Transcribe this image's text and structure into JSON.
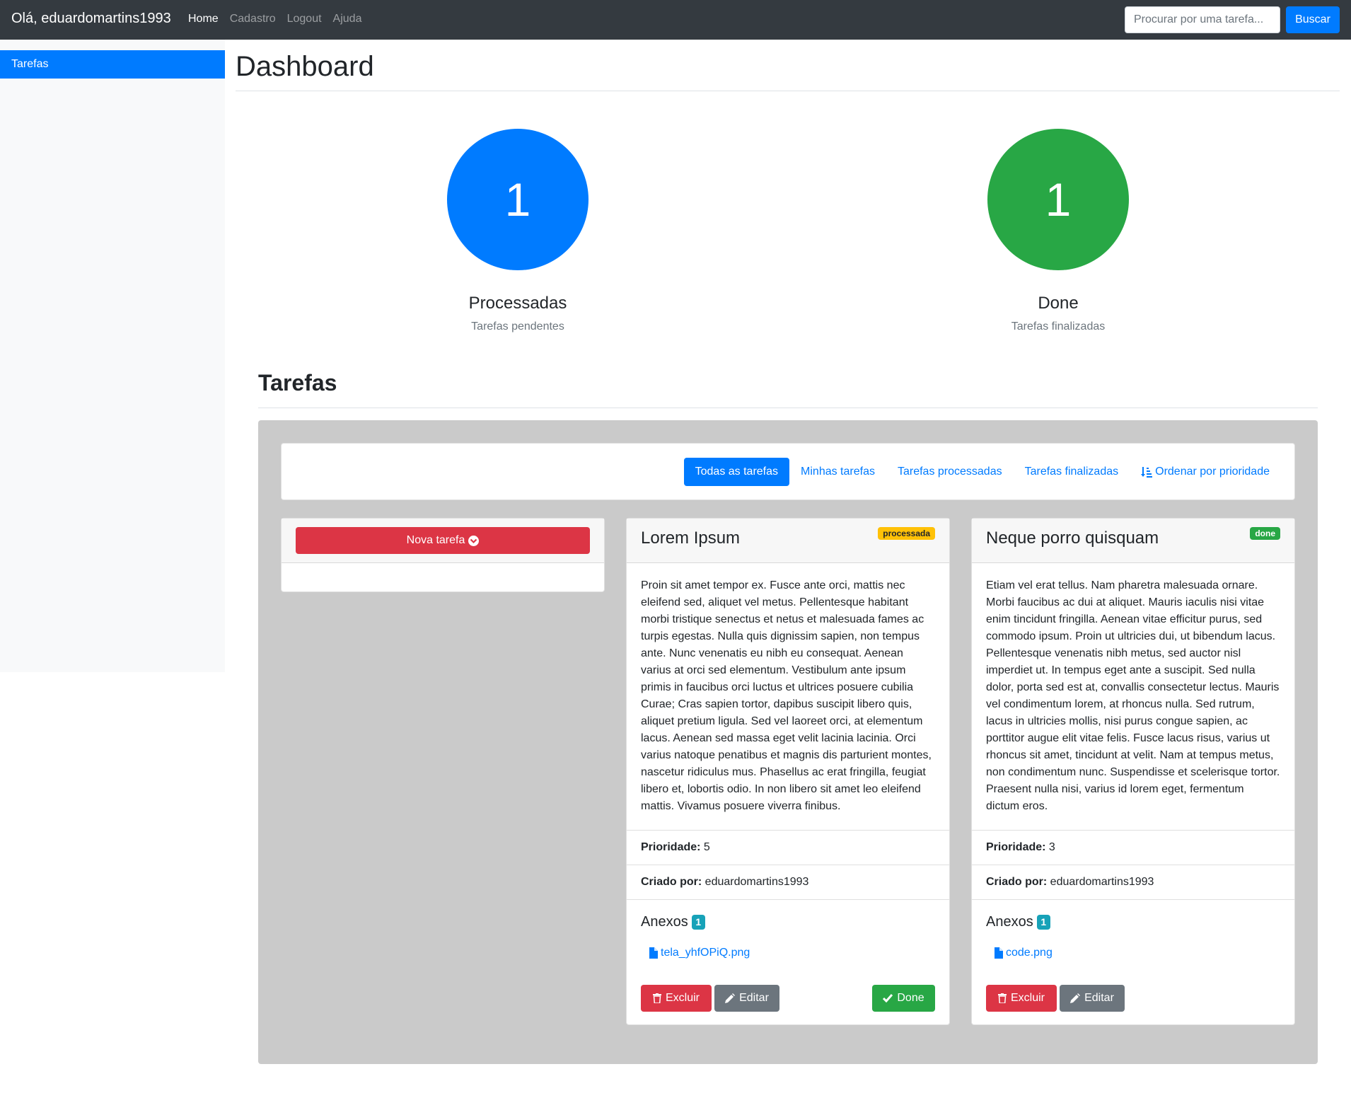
{
  "navbar": {
    "brand": "Olá, eduardomartins1993",
    "links": [
      "Home",
      "Cadastro",
      "Logout",
      "Ajuda"
    ],
    "search_placeholder": "Procurar por uma tarefa...",
    "search_button": "Buscar"
  },
  "sidebar": {
    "items": [
      {
        "label": "Tarefas"
      }
    ]
  },
  "page": {
    "title": "Dashboard",
    "section_title": "Tarefas"
  },
  "stats": [
    {
      "value": "1",
      "label": "Processadas",
      "sub": "Tarefas pendentes",
      "color": "#007bff"
    },
    {
      "value": "1",
      "label": "Done",
      "sub": "Tarefas finalizadas",
      "color": "#28a745"
    }
  ],
  "filters": {
    "tabs": [
      "Todas as tarefas",
      "Minhas tarefas",
      "Tarefas processadas",
      "Tarefas finalizadas"
    ],
    "sort": "Ordenar por prioridade",
    "active": "Todas as tarefas"
  },
  "new_task": {
    "label": "Nova tarefa"
  },
  "labels": {
    "priority": "Prioridade:",
    "created_by": "Criado por:",
    "attachments": "Anexos",
    "delete": "Excluir",
    "edit": "Editar",
    "done": "Done"
  },
  "tasks": [
    {
      "title": "Lorem Ipsum",
      "status": "processada",
      "body": "Proin sit amet tempor ex. Fusce ante orci, mattis nec eleifend sed, aliquet vel metus. Pellentesque habitant morbi tristique senectus et netus et malesuada fames ac turpis egestas. Nulla quis dignissim sapien, non tempus ante. Nunc venenatis eu nibh eu consequat. Aenean varius at orci sed elementum. Vestibulum ante ipsum primis in faucibus orci luctus et ultrices posuere cubilia Curae; Cras sapien tortor, dapibus suscipit libero quis, aliquet pretium ligula. Sed vel laoreet orci, at elementum lacus. Aenean sed massa eget velit lacinia lacinia. Orci varius natoque penatibus et magnis dis parturient montes, nascetur ridiculus mus. Phasellus ac erat fringilla, feugiat libero et, lobortis odio. In non libero sit amet leo eleifend mattis. Vivamus posuere viverra finibus.",
      "priority": "5",
      "created_by": "eduardomartins1993",
      "attachments_count": "1",
      "file": "tela_yhfOPiQ.png"
    },
    {
      "title": "Neque porro quisquam",
      "status": "done",
      "body": "Etiam vel erat tellus. Nam pharetra malesuada ornare. Morbi faucibus ac dui at aliquet. Mauris iaculis nisi vitae enim tincidunt fringilla. Aenean vitae efficitur purus, sed commodo ipsum. Proin ut ultricies dui, ut bibendum lacus. Pellentesque venenatis nibh metus, sed auctor nisl imperdiet ut. In tempus eget ante a suscipit. Sed nulla dolor, porta sed est at, convallis consectetur lectus. Mauris vel condimentum lorem, at rhoncus nulla. Sed rutrum, lacus in ultricies mollis, nisi purus congue sapien, ac porttitor augue elit vitae felis. Fusce lacus risus, varius ut rhoncus sit amet, tincidunt at velit. Nam at tempus metus, non condimentum nunc. Suspendisse et scelerisque tortor. Praesent nulla nisi, varius id lorem eget, fermentum dictum eros.",
      "priority": "3",
      "created_by": "eduardomartins1993",
      "attachments_count": "1",
      "file": "code.png"
    }
  ]
}
